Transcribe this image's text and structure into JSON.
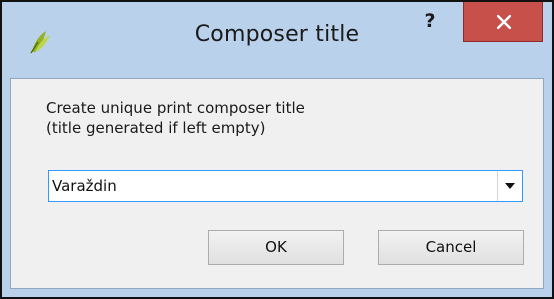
{
  "window": {
    "title": "Composer title",
    "help_glyph": "?",
    "app_icon": "qgis-icon",
    "close_icon": "close-icon"
  },
  "dialog": {
    "description_line1": "Create unique print composer title",
    "description_line2": "(title generated if left empty)",
    "title_input": {
      "value": "Varaždin",
      "dropdown_icon": "chevron-down-icon"
    },
    "buttons": {
      "ok_label": "OK",
      "cancel_label": "Cancel"
    }
  },
  "colors": {
    "titlebar": "#b9d1ea",
    "close_button": "#c7504a",
    "client_background": "#f0f0f0",
    "input_focus_border": "#3399ff"
  }
}
